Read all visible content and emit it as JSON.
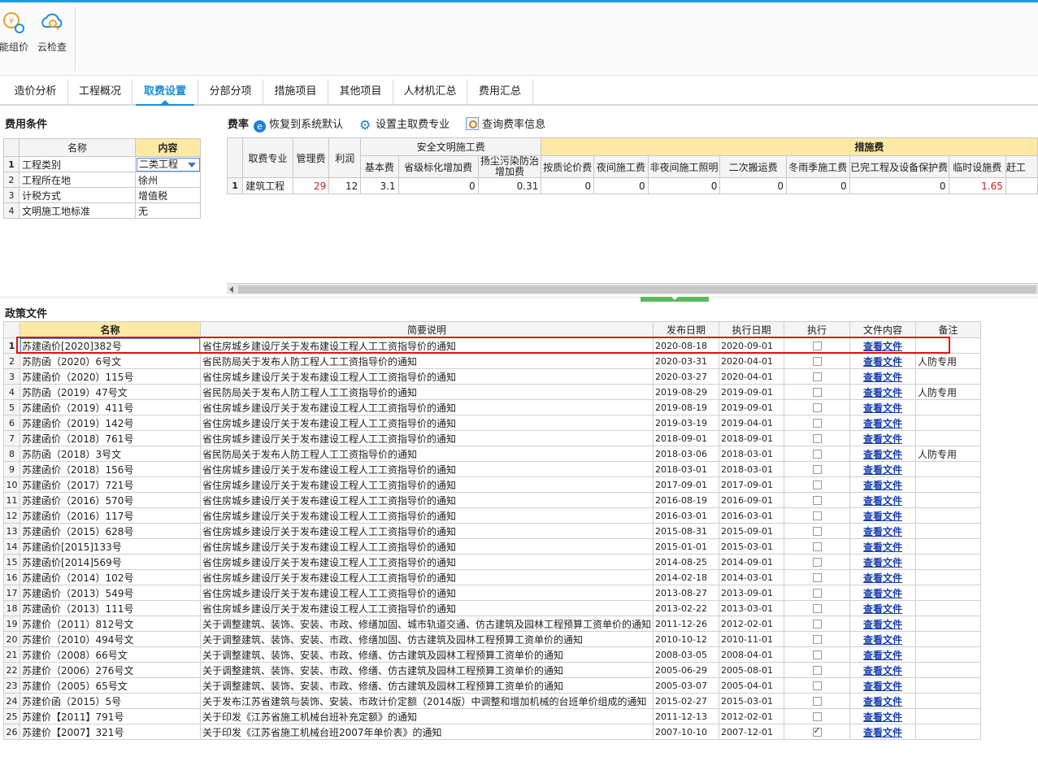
{
  "ribbon": {
    "buttons": [
      {
        "label": "能组价",
        "icon": "smart-pricing-icon"
      },
      {
        "label": "云检查",
        "icon": "cloud-check-icon"
      }
    ]
  },
  "tabs": [
    "造价分析",
    "工程概况",
    "取费设置",
    "分部分项",
    "措施项目",
    "其他项目",
    "人材机汇总",
    "费用汇总"
  ],
  "active_tab": "取费设置",
  "conditions": {
    "title": "费用条件",
    "headers": {
      "name": "名称",
      "content": "内容"
    },
    "rows": [
      {
        "idx": "1",
        "name": "工程类别",
        "value": "二类工程"
      },
      {
        "idx": "2",
        "name": "工程所在地",
        "value": "徐州"
      },
      {
        "idx": "3",
        "name": "计税方式",
        "value": "增值税"
      },
      {
        "idx": "4",
        "name": "文明施工地标准",
        "value": "无"
      }
    ]
  },
  "rate": {
    "toolbar": {
      "title": "费率",
      "restore": "恢复到系统默认",
      "set_main": "设置主取费专业",
      "query": "查询费率信息"
    },
    "headers": {
      "specialty": "取费专业",
      "mgmt": "管理费",
      "profit": "利润",
      "safety_group": "安全文明施工费",
      "measure_group": "措施费",
      "base": "基本费",
      "provincial": "省级标化增加费",
      "dust": "扬尘污染防治增加费",
      "cols": [
        "按质论价费",
        "夜间施工费",
        "非夜间施工照明",
        "二次搬运费",
        "冬雨季施工费",
        "已完工程及设备保护费",
        "临时设施费",
        "赶工"
      ]
    },
    "rows": [
      {
        "idx": "1",
        "specialty": "建筑工程",
        "mgmt": "29",
        "profit": "12",
        "base": "3.1",
        "provincial": "0",
        "dust": "0.31",
        "measures": [
          "0",
          "0",
          "0",
          "0",
          "0",
          "0",
          "1.65",
          ""
        ]
      }
    ]
  },
  "policy": {
    "title": "政策文件",
    "headers": {
      "name": "名称",
      "desc": "简要说明",
      "publish": "发布日期",
      "exec_date": "执行日期",
      "execute": "执行",
      "file": "文件内容",
      "note": "备注"
    },
    "rows": [
      {
        "idx": "1",
        "name": "苏建函价[2020]382号",
        "desc": "省住房城乡建设厅关于发布建设工程人工工资指导价的通知",
        "publish": "2020-08-18",
        "exec_date": "2020-09-01",
        "checked": false,
        "link": "查看文件",
        "note": ""
      },
      {
        "idx": "2",
        "name": "苏防函（2020）6号文",
        "desc": "省民防局关于发布人防工程人工工资指导价的通知",
        "publish": "2020-03-31",
        "exec_date": "2020-04-01",
        "checked": false,
        "link": "查看文件",
        "note": "人防专用"
      },
      {
        "idx": "3",
        "name": "苏建函价（2020）115号",
        "desc": "省住房城乡建设厅关于发布建设工程人工工资指导价的通知",
        "publish": "2020-03-27",
        "exec_date": "2020-04-01",
        "checked": false,
        "link": "查看文件",
        "note": ""
      },
      {
        "idx": "4",
        "name": "苏防函（2019）47号文",
        "desc": "省民防局关于发布人防工程人工工资指导价的通知",
        "publish": "2019-08-29",
        "exec_date": "2019-09-01",
        "checked": false,
        "link": "查看文件",
        "note": "人防专用"
      },
      {
        "idx": "5",
        "name": "苏建函价（2019）411号",
        "desc": "省住房城乡建设厅关于发布建设工程人工工资指导价的通知",
        "publish": "2019-08-19",
        "exec_date": "2019-09-01",
        "checked": false,
        "link": "查看文件",
        "note": ""
      },
      {
        "idx": "6",
        "name": "苏建函价（2019）142号",
        "desc": "省住房城乡建设厅关于发布建设工程人工工资指导价的通知",
        "publish": "2019-03-19",
        "exec_date": "2019-04-01",
        "checked": false,
        "link": "查看文件",
        "note": ""
      },
      {
        "idx": "7",
        "name": "苏建函价（2018）761号",
        "desc": "省住房城乡建设厅关于发布建设工程人工工资指导价的通知",
        "publish": "2018-09-01",
        "exec_date": "2018-09-01",
        "checked": false,
        "link": "查看文件",
        "note": ""
      },
      {
        "idx": "8",
        "name": "苏防函（2018）3号文",
        "desc": "省民防局关于发布人防工程人工工资指导价的通知",
        "publish": "2018-03-06",
        "exec_date": "2018-03-01",
        "checked": false,
        "link": "查看文件",
        "note": "人防专用"
      },
      {
        "idx": "9",
        "name": "苏建函价（2018）156号",
        "desc": "省住房城乡建设厅关于发布建设工程人工工资指导价的通知",
        "publish": "2018-03-01",
        "exec_date": "2018-03-01",
        "checked": false,
        "link": "查看文件",
        "note": ""
      },
      {
        "idx": "10",
        "name": "苏建函价（2017）721号",
        "desc": "省住房城乡建设厅关于发布建设工程人工工资指导价的通知",
        "publish": "2017-09-01",
        "exec_date": "2017-09-01",
        "checked": false,
        "link": "查看文件",
        "note": ""
      },
      {
        "idx": "11",
        "name": "苏建函价（2016）570号",
        "desc": "省住房城乡建设厅关于发布建设工程人工工资指导价的通知",
        "publish": "2016-08-19",
        "exec_date": "2016-09-01",
        "checked": false,
        "link": "查看文件",
        "note": ""
      },
      {
        "idx": "12",
        "name": "苏建函价（2016）117号",
        "desc": "省住房城乡建设厅关于发布建设工程人工工资指导价的通知",
        "publish": "2016-03-01",
        "exec_date": "2016-03-01",
        "checked": false,
        "link": "查看文件",
        "note": ""
      },
      {
        "idx": "13",
        "name": "苏建函价（2015）628号",
        "desc": "省住房城乡建设厅关于发布建设工程人工工资指导价的通知",
        "publish": "2015-08-31",
        "exec_date": "2015-09-01",
        "checked": false,
        "link": "查看文件",
        "note": ""
      },
      {
        "idx": "14",
        "name": "苏建函价[2015]133号",
        "desc": "省住房城乡建设厅关于发布建设工程人工工资指导价的通知",
        "publish": "2015-01-01",
        "exec_date": "2015-03-01",
        "checked": false,
        "link": "查看文件",
        "note": ""
      },
      {
        "idx": "15",
        "name": "苏建函价[2014]569号",
        "desc": "省住房城乡建设厅关于发布建设工程人工工资指导价的通知",
        "publish": "2014-08-25",
        "exec_date": "2014-09-01",
        "checked": false,
        "link": "查看文件",
        "note": ""
      },
      {
        "idx": "16",
        "name": "苏建函价（2014）102号",
        "desc": "省住房城乡建设厅关于发布建设工程人工工资指导价的通知",
        "publish": "2014-02-18",
        "exec_date": "2014-03-01",
        "checked": false,
        "link": "查看文件",
        "note": ""
      },
      {
        "idx": "17",
        "name": "苏建函价（2013）549号",
        "desc": "省住房城乡建设厅关于发布建设工程人工工资指导价的通知",
        "publish": "2013-08-27",
        "exec_date": "2013-09-01",
        "checked": false,
        "link": "查看文件",
        "note": ""
      },
      {
        "idx": "18",
        "name": "苏建函价（2013）111号",
        "desc": "省住房城乡建设厅关于发布建设工程人工工资指导价的通知",
        "publish": "2013-02-22",
        "exec_date": "2013-03-01",
        "checked": false,
        "link": "查看文件",
        "note": ""
      },
      {
        "idx": "19",
        "name": "苏建价（2011）812号文",
        "desc": "关于调整建筑、装饰、安装、市政、修缮加固、城市轨道交通、仿古建筑及园林工程预算工资单价的通知",
        "publish": "2011-12-26",
        "exec_date": "2012-02-01",
        "checked": false,
        "link": "查看文件",
        "note": ""
      },
      {
        "idx": "20",
        "name": "苏建价（2010）494号文",
        "desc": "关于调整建筑、装饰、安装、市政、修缮加固、仿古建筑及园林工程预算工资单价的通知",
        "publish": "2010-10-12",
        "exec_date": "2010-11-01",
        "checked": false,
        "link": "查看文件",
        "note": ""
      },
      {
        "idx": "21",
        "name": "苏建价（2008）66号文",
        "desc": "关于调整建筑、装饰、安装、市政、修缮、仿古建筑及园林工程预算工资单价的通知",
        "publish": "2008-03-05",
        "exec_date": "2008-04-01",
        "checked": false,
        "link": "查看文件",
        "note": ""
      },
      {
        "idx": "22",
        "name": "苏建价（2006）276号文",
        "desc": "关于调整建筑、装饰、安装、市政、修缮、仿古建筑及园林工程预算工资单价的通知",
        "publish": "2005-06-29",
        "exec_date": "2005-08-01",
        "checked": false,
        "link": "查看文件",
        "note": ""
      },
      {
        "idx": "23",
        "name": "苏建价（2005）65号文",
        "desc": "关于调整建筑、装饰、安装、市政、修缮、仿古建筑及园林工程预算工资单价的通知",
        "publish": "2005-03-07",
        "exec_date": "2005-04-01",
        "checked": false,
        "link": "查看文件",
        "note": ""
      },
      {
        "idx": "24",
        "name": "苏建价函（2015）5号",
        "desc": "关于发布江苏省建筑与装饰、安装、市政计价定额（2014版）中调整和增加机械的台班单价组成的通知",
        "publish": "2015-02-27",
        "exec_date": "2015-03-01",
        "checked": false,
        "link": "查看文件",
        "note": ""
      },
      {
        "idx": "25",
        "name": "苏建价【2011】791号",
        "desc": "关于印发《江苏省施工机械台班补充定额》的通知",
        "publish": "2011-12-13",
        "exec_date": "2012-02-01",
        "checked": false,
        "link": "查看文件",
        "note": ""
      },
      {
        "idx": "26",
        "name": "苏建价【2007】321号",
        "desc": "关于印发《江苏省施工机械台班2007年单价表》的通知",
        "publish": "2007-10-10",
        "exec_date": "2007-12-01",
        "checked": true,
        "link": "查看文件",
        "note": ""
      }
    ]
  },
  "colors": {
    "accent": "#1e8fd6",
    "header_highlight": "#fde9a3",
    "link": "#1a3fb0",
    "alert_red": "#e01010",
    "value_red": "#d02020"
  }
}
